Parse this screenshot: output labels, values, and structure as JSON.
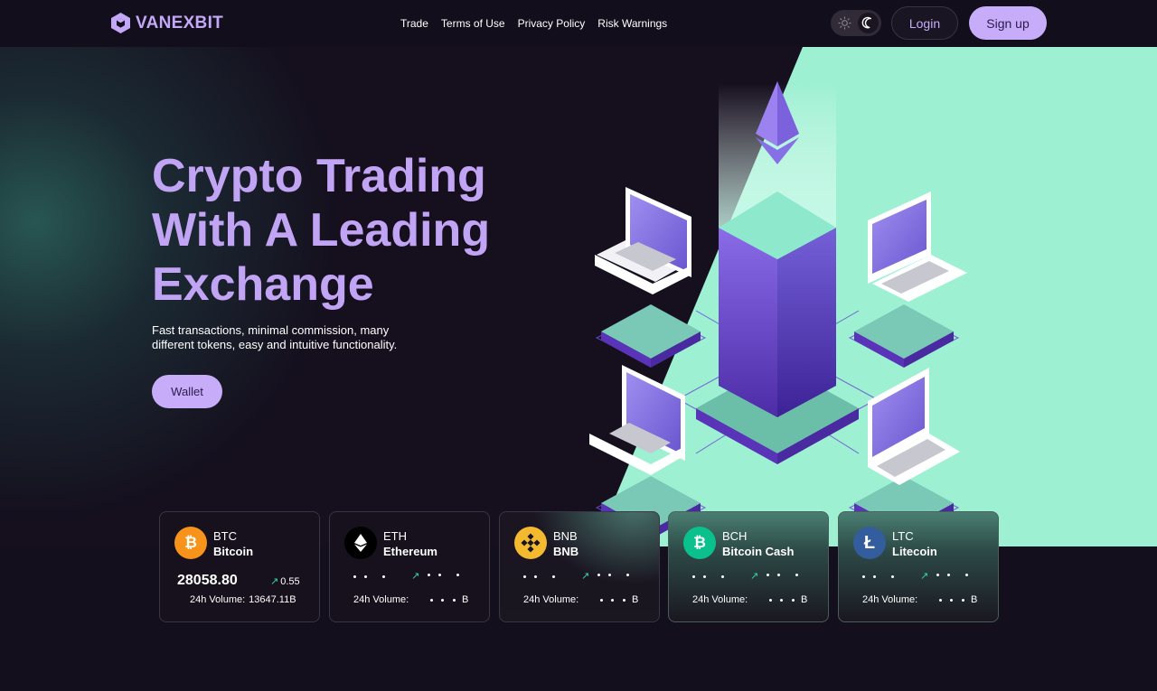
{
  "header": {
    "brand": "VANEXBIT",
    "nav": [
      "Trade",
      "Terms of Use",
      "Privacy Policy",
      "Risk Warnings"
    ],
    "login_label": "Login",
    "signup_label": "Sign up",
    "theme_icons": [
      "sun-icon",
      "moon-icon"
    ]
  },
  "hero": {
    "title_lines": [
      "Crypto Trading",
      "With A Leading",
      "Exchange"
    ],
    "subtitle": "Fast transactions, minimal commission, many different tokens, easy and intuitive functionality.",
    "wallet_label": "Wallet"
  },
  "colors": {
    "accent": "#c7adf9",
    "mint": "#9ef0d3",
    "background": "#150f1e",
    "positive": "#39d3a6"
  },
  "tickers": [
    {
      "symbol": "BTC",
      "name": "Bitcoin",
      "price": "28058.80",
      "change": "0.55",
      "volume_label": "24h Volume:",
      "volume": "13647.11B",
      "icon": "bitcoin-icon",
      "icon_color": "#f7931a",
      "loaded": true
    },
    {
      "symbol": "ETH",
      "name": "Ethereum",
      "price": "",
      "change": "",
      "volume_label": "24h Volume:",
      "volume": "B",
      "icon": "ethereum-icon",
      "icon_color": "#000000",
      "loaded": false
    },
    {
      "symbol": "BNB",
      "name": "BNB",
      "price": "",
      "change": "",
      "volume_label": "24h Volume:",
      "volume": "B",
      "icon": "bnb-icon",
      "icon_color": "#f3ba2f",
      "loaded": false
    },
    {
      "symbol": "BCH",
      "name": "Bitcoin Cash",
      "price": "",
      "change": "",
      "volume_label": "24h Volume:",
      "volume": "B",
      "icon": "bitcoin-cash-icon",
      "icon_color": "#0ac18e",
      "loaded": false
    },
    {
      "symbol": "LTC",
      "name": "Litecoin",
      "price": "",
      "change": "",
      "volume_label": "24h Volume:",
      "volume": "B",
      "icon": "litecoin-icon",
      "icon_color": "#345d9d",
      "loaded": false
    }
  ]
}
